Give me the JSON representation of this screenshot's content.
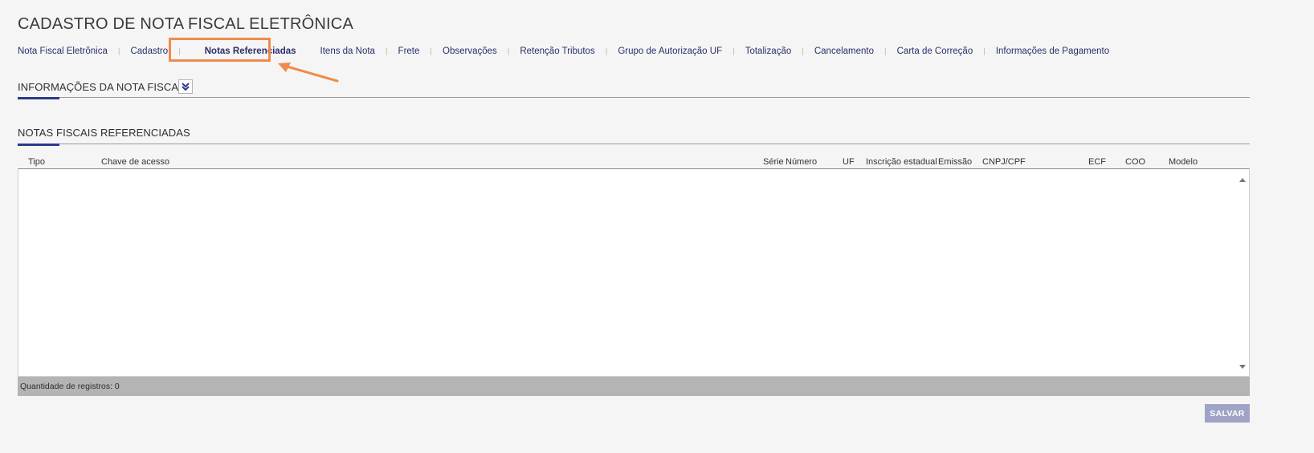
{
  "page": {
    "title": "CADASTRO DE NOTA FISCAL ELETRÔNICA"
  },
  "tabs": [
    {
      "label": "Nota Fiscal Eletrônica",
      "active": false
    },
    {
      "label": "Cadastro",
      "active": false
    },
    {
      "label": "Notas Referenciadas",
      "active": true
    },
    {
      "label": "Itens da Nota",
      "active": false
    },
    {
      "label": "Frete",
      "active": false
    },
    {
      "label": "Observações",
      "active": false
    },
    {
      "label": "Retenção Tributos",
      "active": false
    },
    {
      "label": "Grupo de Autorização UF",
      "active": false
    },
    {
      "label": "Totalização",
      "active": false
    },
    {
      "label": "Cancelamento",
      "active": false
    },
    {
      "label": "Carta de Correção",
      "active": false
    },
    {
      "label": "Informações de Pagamento",
      "active": false
    }
  ],
  "tab_separator": "|",
  "sections": {
    "info": {
      "title": "INFORMAÇÕES DA NOTA FISCAL",
      "toggle_icon": "double-chevron-down-icon"
    },
    "referenced": {
      "title": "NOTAS FISCAIS REFERENCIADAS"
    }
  },
  "grid": {
    "columns": [
      "Tipo",
      "Chave de acesso",
      "Série",
      "Número",
      "UF",
      "Inscrição estadual",
      "Emissão",
      "CNPJ/CPF",
      "ECF",
      "COO",
      "Modelo"
    ],
    "rows": [],
    "footer": "Quantidade de registros: 0"
  },
  "buttons": {
    "save": "SALVAR"
  },
  "colors": {
    "accent": "#2a3a8a",
    "tab_text": "#2a2f6b",
    "highlight": "#f08a4b",
    "save_button": "#9fa3c6",
    "footer_bg": "#b4b4b4"
  }
}
